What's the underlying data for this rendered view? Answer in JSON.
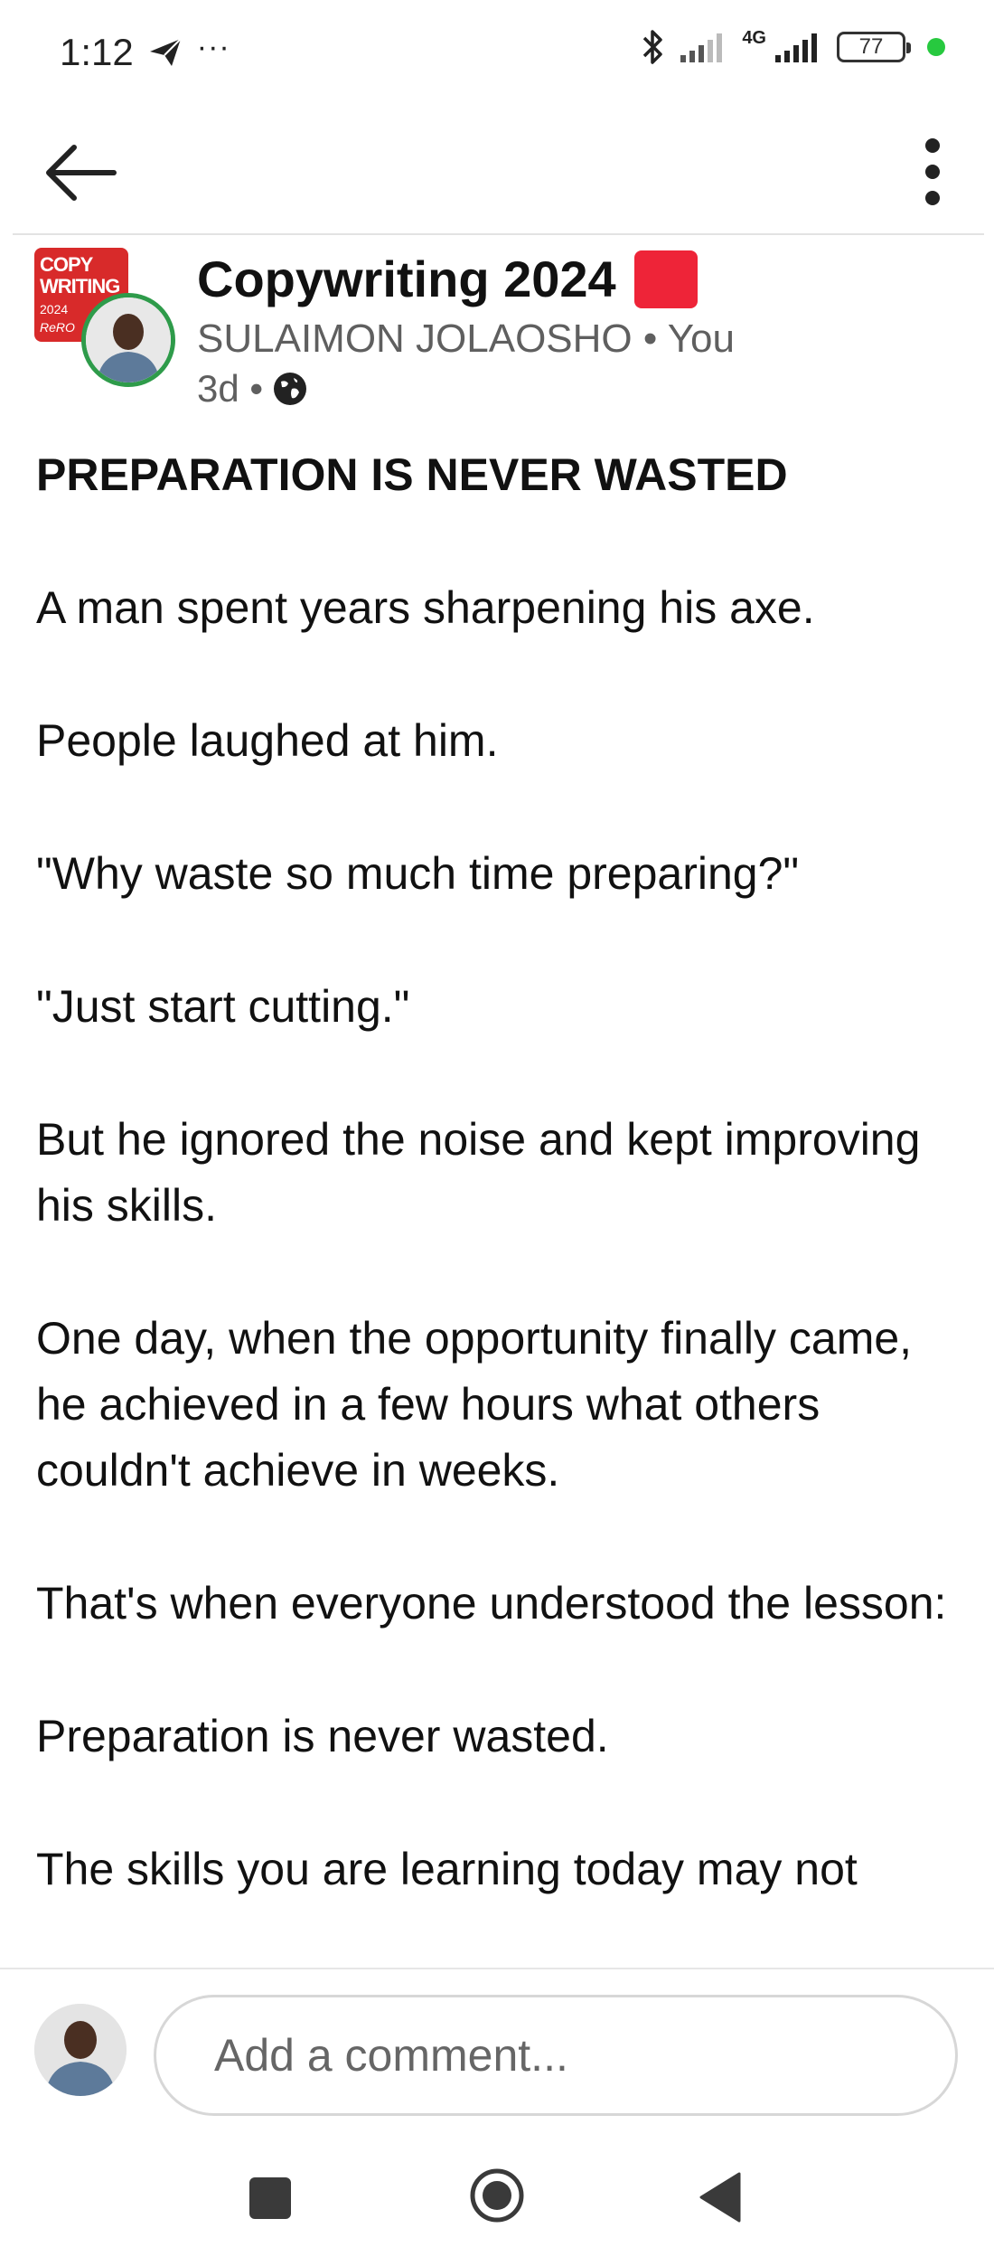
{
  "status_bar": {
    "time": "1:12",
    "more": "···",
    "network": "4G",
    "battery": "77",
    "icons": [
      "telegram-send-icon",
      "bluetooth-icon",
      "signal-icon",
      "signal-4g-icon",
      "battery-icon"
    ]
  },
  "app_bar": {
    "back_icon": "arrow-left-icon",
    "menu_icon": "vertical-dots-icon"
  },
  "post": {
    "group_logo": {
      "line1": "COPY",
      "line2": "WRITING",
      "line3": "2024",
      "line4": "ReRO"
    },
    "group_name": "Copywriting 2024",
    "author": "SULAIMON JOLAOSHO",
    "author_suffix": " • You",
    "age": "3d •",
    "visibility_icon": "globe-icon",
    "heading": "PREPARATION IS NEVER WASTED",
    "paragraphs": [
      "A man spent years sharpening his axe.",
      "People laughed at him.",
      "\"Why waste so much time preparing?\"",
      "\"Just start cutting.\"",
      "But he ignored the noise and kept improving his skills.",
      "One day, when the opportunity finally came, he achieved in a few hours what others couldn't achieve in weeks.",
      "That's when everyone understood the lesson:",
      "Preparation is never wasted.",
      "The skills you are learning today may not"
    ]
  },
  "comment_bar": {
    "placeholder": "Add a comment..."
  },
  "nav_bar": {
    "icons": [
      "recent-apps-icon",
      "home-icon",
      "back-icon"
    ]
  },
  "colors": {
    "accent_red": "#ee2438",
    "logo_red": "#d82a2a",
    "avatar_ring": "#2e9b4a",
    "status_dot": "#27c93f"
  }
}
